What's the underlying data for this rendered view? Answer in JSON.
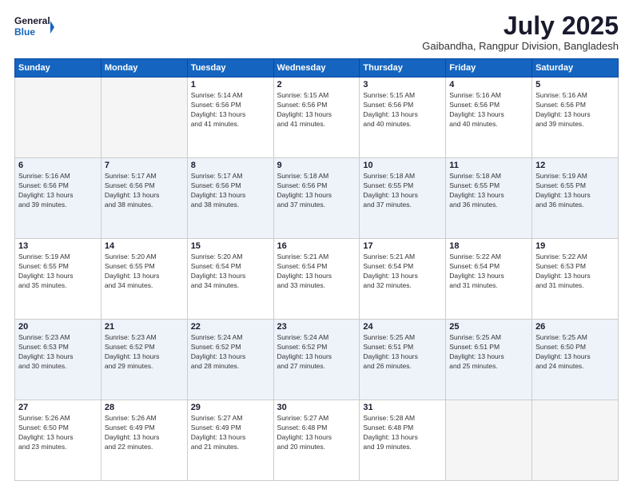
{
  "header": {
    "logo_line1": "General",
    "logo_line2": "Blue",
    "month_title": "July 2025",
    "location": "Gaibandha, Rangpur Division, Bangladesh"
  },
  "days_of_week": [
    "Sunday",
    "Monday",
    "Tuesday",
    "Wednesday",
    "Thursday",
    "Friday",
    "Saturday"
  ],
  "weeks": [
    [
      {
        "day": "",
        "info": ""
      },
      {
        "day": "",
        "info": ""
      },
      {
        "day": "1",
        "info": "Sunrise: 5:14 AM\nSunset: 6:56 PM\nDaylight: 13 hours\nand 41 minutes."
      },
      {
        "day": "2",
        "info": "Sunrise: 5:15 AM\nSunset: 6:56 PM\nDaylight: 13 hours\nand 41 minutes."
      },
      {
        "day": "3",
        "info": "Sunrise: 5:15 AM\nSunset: 6:56 PM\nDaylight: 13 hours\nand 40 minutes."
      },
      {
        "day": "4",
        "info": "Sunrise: 5:16 AM\nSunset: 6:56 PM\nDaylight: 13 hours\nand 40 minutes."
      },
      {
        "day": "5",
        "info": "Sunrise: 5:16 AM\nSunset: 6:56 PM\nDaylight: 13 hours\nand 39 minutes."
      }
    ],
    [
      {
        "day": "6",
        "info": "Sunrise: 5:16 AM\nSunset: 6:56 PM\nDaylight: 13 hours\nand 39 minutes."
      },
      {
        "day": "7",
        "info": "Sunrise: 5:17 AM\nSunset: 6:56 PM\nDaylight: 13 hours\nand 38 minutes."
      },
      {
        "day": "8",
        "info": "Sunrise: 5:17 AM\nSunset: 6:56 PM\nDaylight: 13 hours\nand 38 minutes."
      },
      {
        "day": "9",
        "info": "Sunrise: 5:18 AM\nSunset: 6:56 PM\nDaylight: 13 hours\nand 37 minutes."
      },
      {
        "day": "10",
        "info": "Sunrise: 5:18 AM\nSunset: 6:55 PM\nDaylight: 13 hours\nand 37 minutes."
      },
      {
        "day": "11",
        "info": "Sunrise: 5:18 AM\nSunset: 6:55 PM\nDaylight: 13 hours\nand 36 minutes."
      },
      {
        "day": "12",
        "info": "Sunrise: 5:19 AM\nSunset: 6:55 PM\nDaylight: 13 hours\nand 36 minutes."
      }
    ],
    [
      {
        "day": "13",
        "info": "Sunrise: 5:19 AM\nSunset: 6:55 PM\nDaylight: 13 hours\nand 35 minutes."
      },
      {
        "day": "14",
        "info": "Sunrise: 5:20 AM\nSunset: 6:55 PM\nDaylight: 13 hours\nand 34 minutes."
      },
      {
        "day": "15",
        "info": "Sunrise: 5:20 AM\nSunset: 6:54 PM\nDaylight: 13 hours\nand 34 minutes."
      },
      {
        "day": "16",
        "info": "Sunrise: 5:21 AM\nSunset: 6:54 PM\nDaylight: 13 hours\nand 33 minutes."
      },
      {
        "day": "17",
        "info": "Sunrise: 5:21 AM\nSunset: 6:54 PM\nDaylight: 13 hours\nand 32 minutes."
      },
      {
        "day": "18",
        "info": "Sunrise: 5:22 AM\nSunset: 6:54 PM\nDaylight: 13 hours\nand 31 minutes."
      },
      {
        "day": "19",
        "info": "Sunrise: 5:22 AM\nSunset: 6:53 PM\nDaylight: 13 hours\nand 31 minutes."
      }
    ],
    [
      {
        "day": "20",
        "info": "Sunrise: 5:23 AM\nSunset: 6:53 PM\nDaylight: 13 hours\nand 30 minutes."
      },
      {
        "day": "21",
        "info": "Sunrise: 5:23 AM\nSunset: 6:52 PM\nDaylight: 13 hours\nand 29 minutes."
      },
      {
        "day": "22",
        "info": "Sunrise: 5:24 AM\nSunset: 6:52 PM\nDaylight: 13 hours\nand 28 minutes."
      },
      {
        "day": "23",
        "info": "Sunrise: 5:24 AM\nSunset: 6:52 PM\nDaylight: 13 hours\nand 27 minutes."
      },
      {
        "day": "24",
        "info": "Sunrise: 5:25 AM\nSunset: 6:51 PM\nDaylight: 13 hours\nand 26 minutes."
      },
      {
        "day": "25",
        "info": "Sunrise: 5:25 AM\nSunset: 6:51 PM\nDaylight: 13 hours\nand 25 minutes."
      },
      {
        "day": "26",
        "info": "Sunrise: 5:25 AM\nSunset: 6:50 PM\nDaylight: 13 hours\nand 24 minutes."
      }
    ],
    [
      {
        "day": "27",
        "info": "Sunrise: 5:26 AM\nSunset: 6:50 PM\nDaylight: 13 hours\nand 23 minutes."
      },
      {
        "day": "28",
        "info": "Sunrise: 5:26 AM\nSunset: 6:49 PM\nDaylight: 13 hours\nand 22 minutes."
      },
      {
        "day": "29",
        "info": "Sunrise: 5:27 AM\nSunset: 6:49 PM\nDaylight: 13 hours\nand 21 minutes."
      },
      {
        "day": "30",
        "info": "Sunrise: 5:27 AM\nSunset: 6:48 PM\nDaylight: 13 hours\nand 20 minutes."
      },
      {
        "day": "31",
        "info": "Sunrise: 5:28 AM\nSunset: 6:48 PM\nDaylight: 13 hours\nand 19 minutes."
      },
      {
        "day": "",
        "info": ""
      },
      {
        "day": "",
        "info": ""
      }
    ]
  ]
}
